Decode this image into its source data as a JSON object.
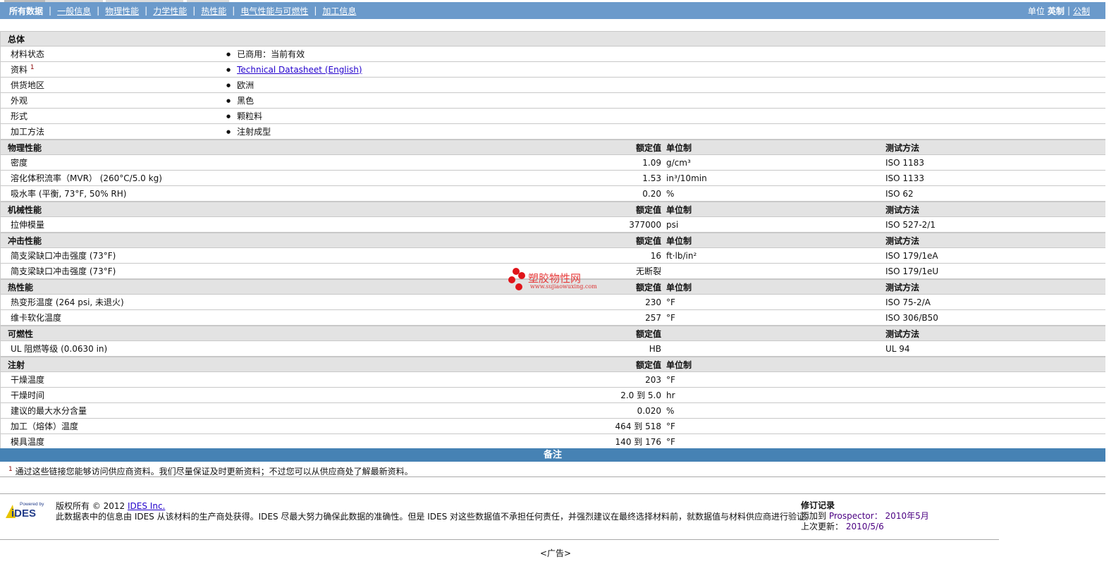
{
  "nav": {
    "items": [
      "所有数据",
      "一般信息",
      "物理性能",
      "力学性能",
      "热性能",
      "电气性能与可燃性",
      "加工信息"
    ],
    "units_label": "单位",
    "unit_english": "英制",
    "unit_metric": "公制"
  },
  "sections": [
    {
      "title": "总体",
      "bullets": true,
      "rows": [
        {
          "name": "材料状态",
          "value": "已商用：当前有效"
        },
        {
          "name": "资料",
          "sup": "1",
          "value": "Technical Datasheet (English)",
          "link": true
        },
        {
          "name": "供货地区",
          "value": "欧洲"
        },
        {
          "name": "外观",
          "value": "黑色"
        },
        {
          "name": "形式",
          "value": "颗粒料"
        },
        {
          "name": "加工方法",
          "value": "注射成型"
        }
      ]
    },
    {
      "title": "物理性能",
      "h_val": "额定值",
      "h_unit": "单位制",
      "h_test": "测试方法",
      "rows": [
        {
          "name": "密度",
          "value": "1.09",
          "unit": "g/cm³",
          "test": "ISO 1183"
        },
        {
          "name": "溶化体积流率（MVR） (260°C/5.0 kg)",
          "value": "1.53",
          "unit": "in³/10min",
          "test": "ISO 1133"
        },
        {
          "name": "吸水率 (平衡, 73°F, 50% RH)",
          "value": "0.20",
          "unit": "%",
          "test": "ISO 62"
        }
      ]
    },
    {
      "title": "机械性能",
      "h_val": "额定值",
      "h_unit": "单位制",
      "h_test": "测试方法",
      "rows": [
        {
          "name": "拉伸模量",
          "value": "377000",
          "unit": "psi",
          "test": "ISO 527-2/1"
        }
      ]
    },
    {
      "title": "冲击性能",
      "h_val": "额定值",
      "h_unit": "单位制",
      "h_test": "测试方法",
      "rows": [
        {
          "name": "简支梁缺口冲击强度 (73°F)",
          "value": "16",
          "unit": "ft·lb/in²",
          "test": "ISO 179/1eA"
        },
        {
          "name": "简支梁缺口冲击强度 (73°F)",
          "value": "无断裂",
          "unit": "",
          "test": "ISO 179/1eU"
        }
      ]
    },
    {
      "title": "热性能",
      "h_val": "额定值",
      "h_unit": "单位制",
      "h_test": "测试方法",
      "rows": [
        {
          "name": "热变形温度 (264 psi, 未退火)",
          "value": "230",
          "unit": "°F",
          "test": "ISO 75-2/A"
        },
        {
          "name": "维卡软化温度",
          "value": "257",
          "unit": "°F",
          "test": "ISO 306/B50"
        }
      ]
    },
    {
      "title": "可燃性",
      "h_val": "额定值",
      "h_test": "测试方法",
      "rows": [
        {
          "name": "UL 阻燃等级 (0.0630 in)",
          "value": "HB",
          "unit": "",
          "test": "UL 94"
        }
      ]
    },
    {
      "title": "注射",
      "h_val": "额定值",
      "h_unit": "单位制",
      "rows": [
        {
          "name": "干燥温度",
          "value": "203",
          "unit": "°F"
        },
        {
          "name": "干燥时间",
          "value": "2.0 到 5.0",
          "unit": "hr"
        },
        {
          "name": "建议的最大水分含量",
          "value": "0.020",
          "unit": "%"
        },
        {
          "name": "加工（熔体）温度",
          "value": "464 到 518",
          "unit": "°F"
        },
        {
          "name": "模具温度",
          "value": "140 到 176",
          "unit": "°F"
        }
      ]
    }
  ],
  "notes": {
    "title": "备注",
    "footnote_mark": "1",
    "footnote": "通过这些链接您能够访问供应商资料。我们尽量保证及时更新资料；不过您可以从供应商处了解最新资料。"
  },
  "footer": {
    "logo_text": "Powered by IDES",
    "copyright": "版权所有 © 2012",
    "company_link": "IDES Inc.",
    "disclaimer": "此数据表中的信息由 IDES 从该材料的生产商处获得。IDES 尽最大努力确保此数据的准确性。但是 IDES 对这些数据值不承担任何责任，并强烈建议在最终选择材料前，就数据值与材料供应商进行验证。",
    "rev_title": "修订记录",
    "added_label": "添加到",
    "added_target": "Prospector：",
    "added_date": "2010年5月",
    "updated_label": "上次更新：",
    "updated_date": "2010/5/6",
    "ad": "<广告>"
  },
  "watermark": {
    "text": "塑胶物性网",
    "url": "www.sujiaowuxing.com"
  }
}
